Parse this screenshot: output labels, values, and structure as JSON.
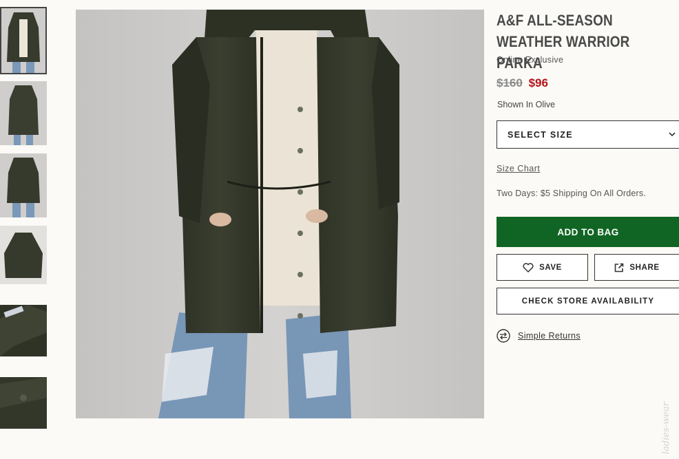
{
  "thumbnails": [
    {
      "label": "front view",
      "active": true
    },
    {
      "label": "back view",
      "active": false
    },
    {
      "label": "front unzipped",
      "active": false
    },
    {
      "label": "flat lay",
      "active": false
    },
    {
      "label": "detail collar",
      "active": false
    },
    {
      "label": "detail pocket",
      "active": false
    }
  ],
  "product": {
    "title": "A&F ALL-SEASON WEATHER WARRIOR PARKA",
    "badge": "Online Exclusive",
    "price_original": "$160",
    "price_sale": "$96",
    "color_text": "Shown In Olive",
    "select_size_label": "SELECT SIZE",
    "size_chart_label": "Size Chart",
    "shipping_text": "Two Days: $5 Shipping On All Orders.",
    "add_to_bag_label": "ADD TO BAG",
    "save_label": "SAVE",
    "share_label": "SHARE",
    "check_store_label": "CHECK STORE AVAILABILITY",
    "returns_label": "Simple Returns"
  },
  "colors": {
    "primary_button": "#116524",
    "sale_price": "#b4121b",
    "background": "#fbfaf6",
    "jacket": "#363a2c"
  },
  "icons": [
    "heart-icon",
    "share-icon",
    "chevron-down-icon",
    "returns-icon"
  ],
  "watermark": "ladies-wear"
}
